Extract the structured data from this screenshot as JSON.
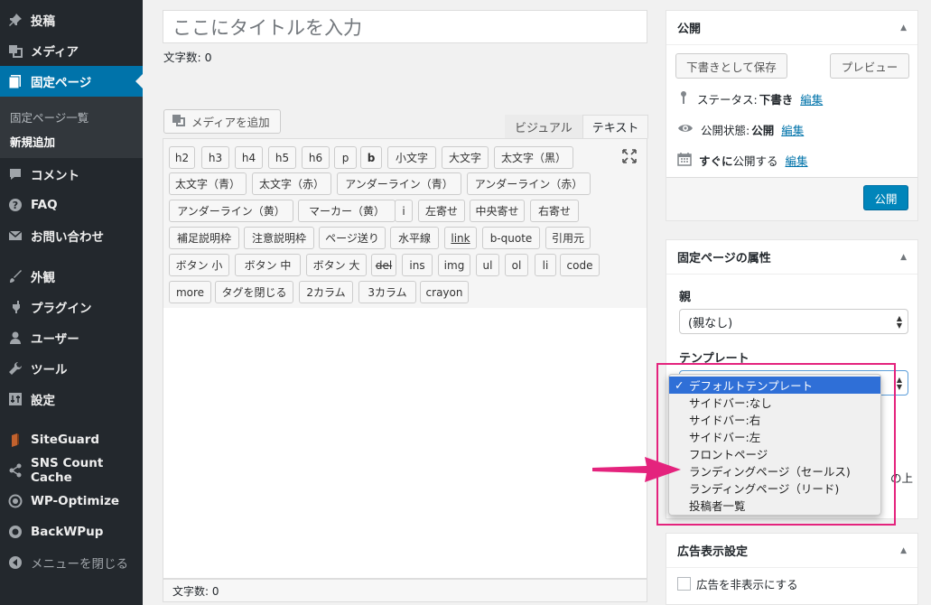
{
  "sidebar": {
    "items": [
      {
        "label": "投稿",
        "icon": "pin-icon"
      },
      {
        "label": "メディア",
        "icon": "media-icon"
      },
      {
        "label": "固定ページ",
        "icon": "page-icon"
      },
      {
        "label": "コメント",
        "icon": "comment-icon"
      },
      {
        "label": "FAQ",
        "icon": "question-icon"
      },
      {
        "label": "お問い合わせ",
        "icon": "mail-icon"
      },
      {
        "label": "外観",
        "icon": "brush-icon"
      },
      {
        "label": "プラグイン",
        "icon": "plugin-icon"
      },
      {
        "label": "ユーザー",
        "icon": "user-icon"
      },
      {
        "label": "ツール",
        "icon": "wrench-icon"
      },
      {
        "label": "設定",
        "icon": "settings-icon"
      },
      {
        "label": "SiteGuard",
        "icon": "siteguard-icon"
      },
      {
        "label": "SNS Count Cache",
        "icon": "share-icon"
      },
      {
        "label": "WP-Optimize",
        "icon": "optimize-icon"
      },
      {
        "label": "BackWPup",
        "icon": "backwpup-icon"
      },
      {
        "label": "メニューを閉じる",
        "icon": "collapse-icon"
      }
    ],
    "submenu": [
      "固定ページ一覧",
      "新規追加"
    ]
  },
  "editor": {
    "title_placeholder": "ここにタイトルを入力",
    "wordcount_top": "文字数: 0",
    "media_button": "メディアを追加",
    "tab_visual": "ビジュアル",
    "tab_text": "テキスト",
    "quicktags": [
      "h2",
      "h3",
      "h4",
      "h5",
      "h6",
      "p",
      "b",
      "小文字",
      "大文字",
      "太文字（黒）",
      "太文字（青）",
      "太文字（赤）",
      "アンダーライン（青）",
      "アンダーライン（赤）",
      "アンダーライン（黄）",
      "マーカー（黄）",
      "i",
      "左寄せ",
      "中央寄せ",
      "右寄せ",
      "補足説明枠",
      "注意説明枠",
      "ページ送り",
      "水平線",
      "link",
      "b-quote",
      "引用元",
      "ボタン 小",
      "ボタン 中",
      "ボタン 大",
      "del",
      "ins",
      "img",
      "ul",
      "ol",
      "li",
      "code",
      "more",
      "タグを閉じる",
      "2カラム",
      "3カラム",
      "crayon"
    ],
    "wordcount_bottom": "文字数: 0"
  },
  "publish": {
    "title": "公開",
    "save_draft": "下書きとして保存",
    "preview": "プレビュー",
    "status_label": "ステータス:",
    "status_value": "下書き",
    "visibility_label": "公開状態:",
    "visibility_value": "公開",
    "schedule_bold": "すぐに",
    "schedule_text": "公開する",
    "edit": "編集",
    "publish_button": "公開"
  },
  "attributes": {
    "title": "固定ページの属性",
    "parent_label": "親",
    "parent_value": "(親なし)",
    "template_label": "テンプレート",
    "template_options": [
      "デフォルトテンプレート",
      "サイドバー:なし",
      "サイドバー:右",
      "サイドバー:左",
      "フロントページ",
      "ランディングページ（セールス)",
      "ランディングページ（リード)",
      "投稿者一覧"
    ],
    "checkmark": "✓",
    "hidden_text_fragment": "の上"
  },
  "ads": {
    "title": "広告表示設定",
    "checkbox_label": "広告を非表示にする"
  },
  "colors": {
    "accent": "#0073aa",
    "highlight": "#e4237d",
    "selected_option": "#2f6fd7"
  }
}
